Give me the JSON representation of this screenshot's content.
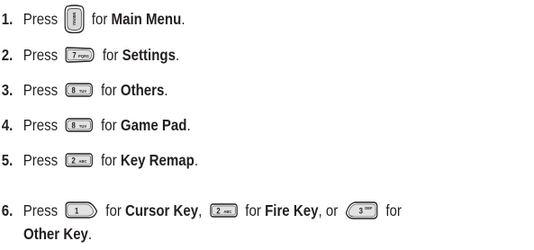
{
  "steps": [
    {
      "number": "1.",
      "press": "Press",
      "key_label": "MENU",
      "for": "for",
      "target": "Main Menu",
      "end": "."
    },
    {
      "number": "2.",
      "press": "Press",
      "key_digit": "7",
      "key_letters": "PQRS",
      "for": "for",
      "target": "Settings",
      "end": "."
    },
    {
      "number": "3.",
      "press": "Press",
      "key_digit": "8",
      "key_letters": "TUV",
      "for": "for",
      "target": "Others",
      "end": "."
    },
    {
      "number": "4.",
      "press": "Press",
      "key_digit": "8",
      "key_letters": "TUV",
      "for": "for",
      "target": "Game Pad",
      "end": "."
    },
    {
      "number": "5.",
      "press": "Press",
      "key_digit": "2",
      "key_letters": "ABC",
      "for": "for",
      "target": "Key Remap",
      "end": "."
    },
    {
      "number": "6.",
      "press": "Press",
      "key1_digit": "1",
      "for1": "for",
      "target1": "Cursor Key",
      "sep1": ",",
      "key2_digit": "2",
      "key2_letters": "ABC",
      "for2": "for",
      "target2": "Fire Key",
      "sep2": ", or",
      "key3_digit": "3",
      "key3_letters": "DEF",
      "for3": "for",
      "target3": "Other Key",
      "end": "."
    }
  ]
}
